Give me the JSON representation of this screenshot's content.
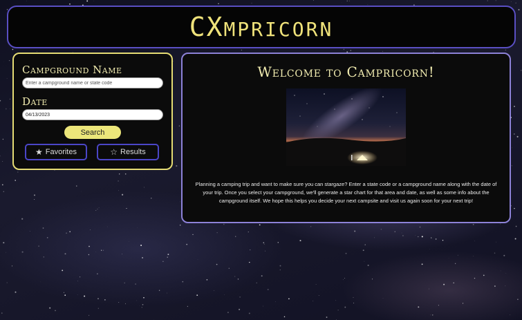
{
  "app": {
    "title": "Campricorn"
  },
  "header": {
    "logo_main": "CX",
    "logo_rest": "MPRICORN"
  },
  "search": {
    "name_label": "Campground Name",
    "name_placeholder": "Enter a campground name or state code",
    "date_label": "Date",
    "date_value": "04/13/2023",
    "search_button": "Search"
  },
  "nav": {
    "favorites": {
      "label": "Favorites",
      "icon": "star-filled-icon"
    },
    "results": {
      "label": "Results",
      "icon": "star-outline-icon"
    }
  },
  "welcome": {
    "title": "Welcome to Campricorn!",
    "description": "Planning a camping trip and want to make sure you can stargaze? Enter a state code or a campground name along with the date of your trip. Once you select your campground, we'll generate a star chart for that area and date, as well as some info about the campground itself. We hope this helps you decide your next campsite and visit us again soon for your next trip!"
  },
  "colors": {
    "accent_yellow": "#e6dd74",
    "accent_purple": "#5a4fc4",
    "panel_bg": "#0b0b0b"
  }
}
